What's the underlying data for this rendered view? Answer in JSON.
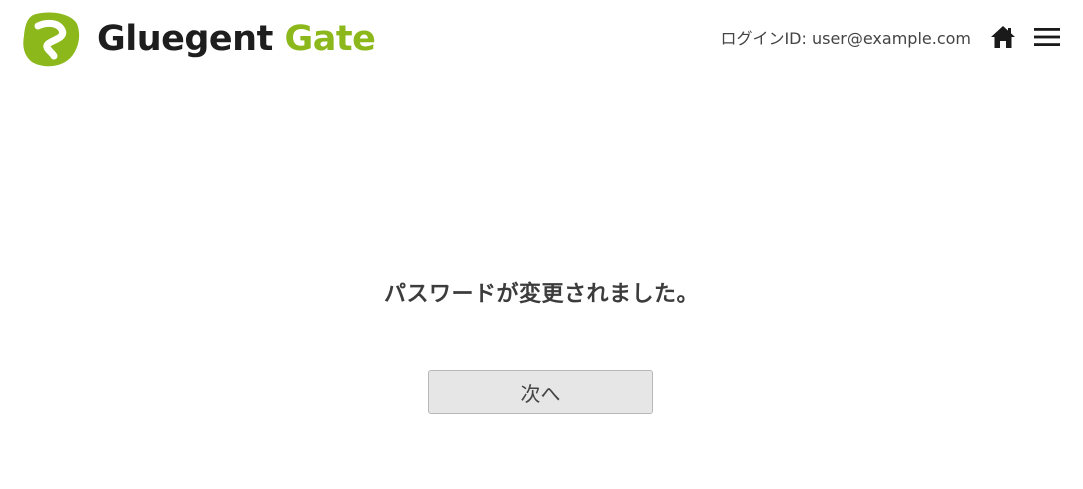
{
  "header": {
    "logo": {
      "word1": "Gluegent",
      "word2": "Gate",
      "icon": "gluegent-logo-icon",
      "colors": {
        "brand_green": "#8cb81c",
        "brand_dark": "#1e1e1e"
      }
    },
    "login_label": "ログインID: user@example.com",
    "home_icon": "home-icon",
    "menu_icon": "hamburger-menu-icon"
  },
  "main": {
    "message": "パスワードが変更されました。",
    "next_button_label": "次へ"
  }
}
